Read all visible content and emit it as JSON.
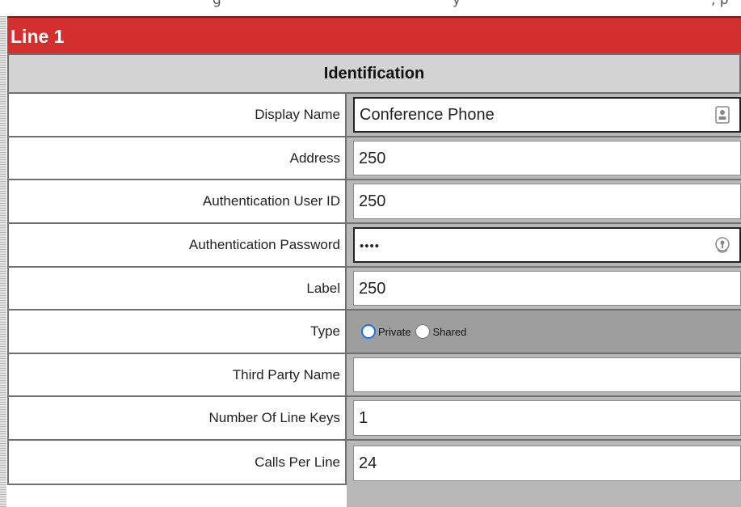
{
  "top_strip": {
    "left_fragment": "g",
    "middle_fragment": "y",
    "right_fragment": ", p"
  },
  "line_title": "Line 1",
  "section_title": "Identification",
  "fields": {
    "display_name": {
      "label": "Display Name",
      "value": "Conference Phone"
    },
    "address": {
      "label": "Address",
      "value": "250"
    },
    "auth_user_id": {
      "label": "Authentication User ID",
      "value": "250"
    },
    "auth_password": {
      "label": "Authentication Password",
      "value": "••••"
    },
    "label": {
      "label": "Label",
      "value": "250"
    },
    "type": {
      "label": "Type",
      "options": [
        {
          "label": "Private",
          "selected": true
        },
        {
          "label": "Shared",
          "selected": false
        }
      ]
    },
    "third_party_name": {
      "label": "Third Party Name",
      "value": ""
    },
    "number_of_line_keys": {
      "label": "Number Of Line Keys",
      "value": "1"
    },
    "calls_per_line": {
      "label": "Calls Per Line",
      "value": "24"
    }
  },
  "colors": {
    "header_red": "#d32f2f",
    "section_gray": "#d3d3d3",
    "radio_blue": "#1a73e8"
  },
  "icons": {
    "display_name_field": "contact-card-icon",
    "password_field": "password-key-icon"
  }
}
